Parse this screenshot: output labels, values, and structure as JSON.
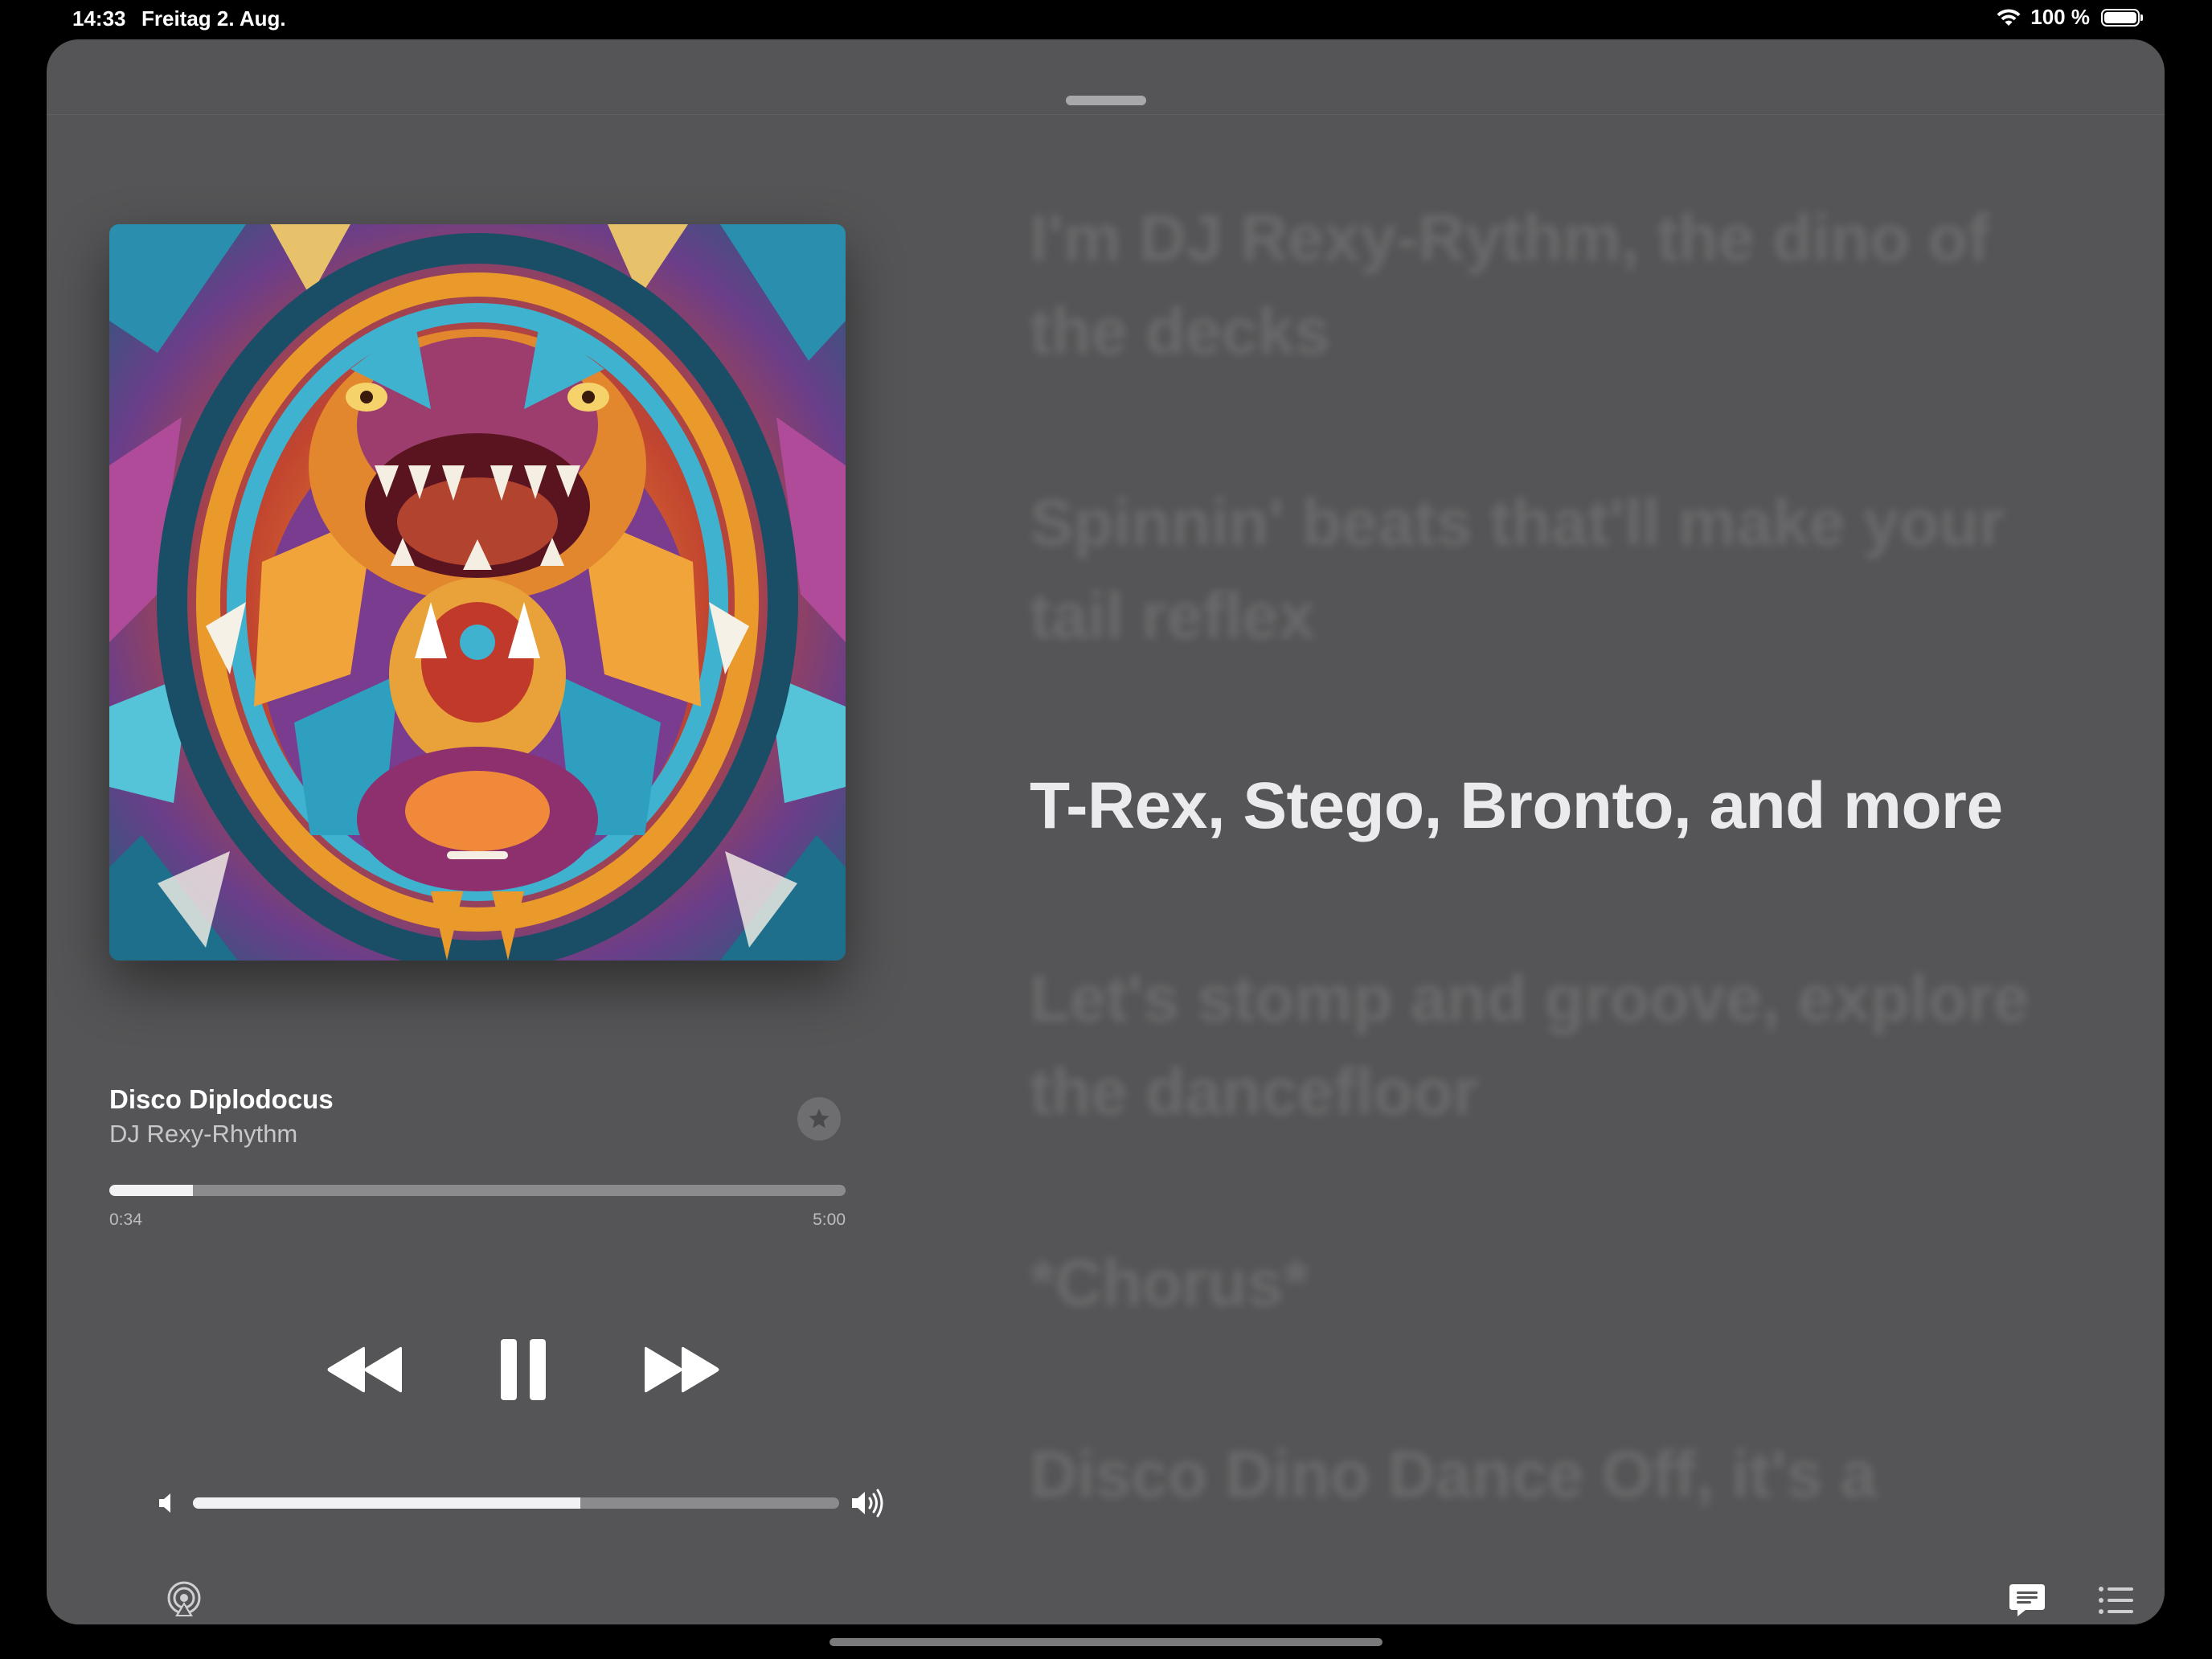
{
  "status_bar": {
    "time": "14:33",
    "date": "Freitag 2. Aug.",
    "battery": "100 %",
    "wifi_icon": "wifi-icon",
    "battery_icon": "battery-icon"
  },
  "now_playing": {
    "title": "Disco Diplodocus",
    "artist": "DJ Rexy-Rhythm",
    "artwork": "album-artwork-dinosaur",
    "favorite_icon": "star-icon",
    "progress": {
      "elapsed": "0:34",
      "total": "5:00",
      "fraction": 0.113
    },
    "controls": {
      "rewind_icon": "rewind-icon",
      "pause_icon": "pause-icon",
      "forward_icon": "fast-forward-icon"
    },
    "volume": {
      "level": 0.6,
      "low_icon": "speaker-low-icon",
      "high_icon": "speaker-high-icon"
    },
    "bottom_bar": {
      "airplay_icon": "airplay-icon",
      "lyrics_icon": "lyrics-bubble-icon",
      "queue_icon": "queue-list-icon"
    }
  },
  "lyrics": {
    "lines": [
      "I'm DJ Rexy-Rythm, the dino of",
      "the decks",
      "Spinnin' beats that'll make your",
      "tail reflex",
      "T-Rex, Stego, Bronto, and more",
      "Let's stomp and groove, explore",
      "the dancefloor",
      "*Chorus*",
      "Disco Dino Dance Off, it's a"
    ],
    "active_index": 4
  },
  "colors": {
    "sheet_background": "#555557",
    "active_lyric": "#ebebed",
    "progress_fill": "#f2f2f4",
    "progress_track": "#8b8b8d"
  }
}
